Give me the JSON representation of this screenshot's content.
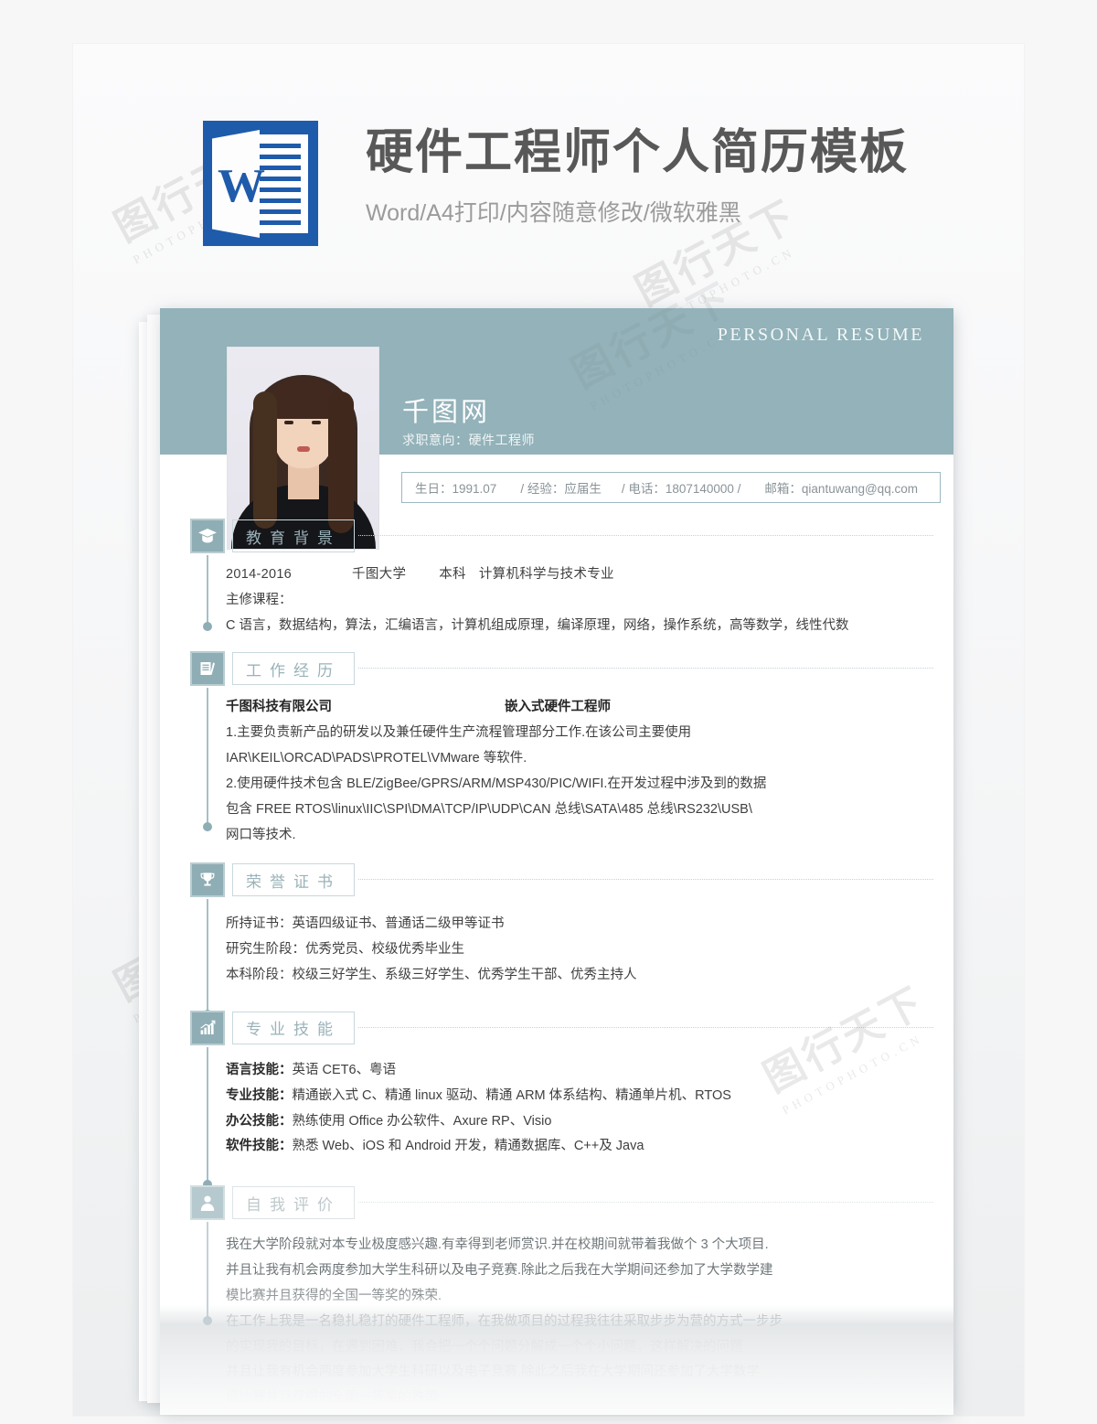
{
  "promo": {
    "logo_letter": "W",
    "logo_name": "word-document-icon",
    "title": "硬件工程师个人简历模板",
    "subtitle": "Word/A4打印/内容随意修改/微软雅黑"
  },
  "resume": {
    "banner_label": "PERSONAL  RESUME",
    "name": "千图网",
    "objective": "求职意向：硬件工程师",
    "contact": {
      "birthday": "生日：1991.07",
      "sep1": "/ 经验：应届生",
      "sep2": "/ 电话：1807140000 /",
      "email": "邮箱：qiantuwang@qq.com"
    },
    "sections": [
      {
        "id": "education",
        "icon": "graduation-cap-icon",
        "title": "教育背景",
        "lines": {
          "years": "2014-2016",
          "school": "千图大学",
          "degree": "本科",
          "major": "计算机科学与技术专业",
          "courses_label": "主修课程：",
          "courses": "C 语言，数据结构，算法，汇编语言，计算机组成原理，编译原理，网络，操作系统，高等数学，线性代数"
        }
      },
      {
        "id": "work",
        "icon": "briefcase-icon",
        "title": "工作经历",
        "company": "千图科技有限公司",
        "position": "嵌入式硬件工程师",
        "bullets": [
          "1.主要负责新产品的研发以及兼任硬件生产流程管理部分工作.在该公司主要使用",
          "IAR\\KEIL\\ORCAD\\PADS\\PROTEL\\VMware 等软件.",
          "2.使用硬件技术包含 BLE/ZigBee/GPRS/ARM/MSP430/PIC/WIFI.在开发过程中涉及到的数据",
          "包含 FREE RTOS\\linux\\IIC\\SPI\\DMA\\TCP/IP\\UDP\\CAN 总线\\SATA\\485 总线\\RS232\\USB\\",
          "网口等技术."
        ]
      },
      {
        "id": "honors",
        "icon": "trophy-icon",
        "title": "荣誉证书",
        "lines": [
          "所持证书：英语四级证书、普通话二级甲等证书",
          "研究生阶段：优秀党员、校级优秀毕业生",
          "本科阶段：校级三好学生、系级三好学生、优秀学生干部、优秀主持人"
        ]
      },
      {
        "id": "skills",
        "icon": "bar-chart-icon",
        "title": "专业技能",
        "rows": [
          {
            "label": "语言技能：",
            "value": "英语 CET6、粤语"
          },
          {
            "label": "专业技能：",
            "value": "精通嵌入式 C、精通 linux 驱动、精通 ARM 体系结构、精通单片机、RTOS"
          },
          {
            "label": "办公技能：",
            "value": "熟练使用 Office 办公软件、Axure RP、Visio"
          },
          {
            "label": "软件技能：",
            "value": "熟悉 Web、iOS 和 Android 开发，精通数据库、C++及 Java"
          }
        ]
      },
      {
        "id": "self",
        "icon": "user-icon",
        "title": "自我评价",
        "paragraphs": [
          "我在大学阶段就对本专业极度感兴趣.有幸得到老师赏识.并在校期间就带着我做个 3 个大项目.",
          "并且让我有机会两度参加大学生科研以及电子竞赛.除此之后我在大学期间还参加了大学数学建",
          "模比赛并且获得的全国一等奖的殊荣.",
          "在工作上我是一名稳扎稳打的硬件工程师，在我做项目的过程我往往采取步步为营的方式一步步",
          "的实现我的目标，在遇到困难，我会把一个个问题分解成一个个小问题，这样解决的问题"
        ],
        "tail_paragraphs": [
          "并且让我有机会两度参加大学生科研以及电子竞赛.除此之后我在大学期间还参加了大学数学",
          "模比赛并且获得的全国一等奖的殊荣."
        ]
      }
    ]
  },
  "watermark": {
    "big": "图行天下",
    "small": "PHOTOPHOTO.CN"
  }
}
